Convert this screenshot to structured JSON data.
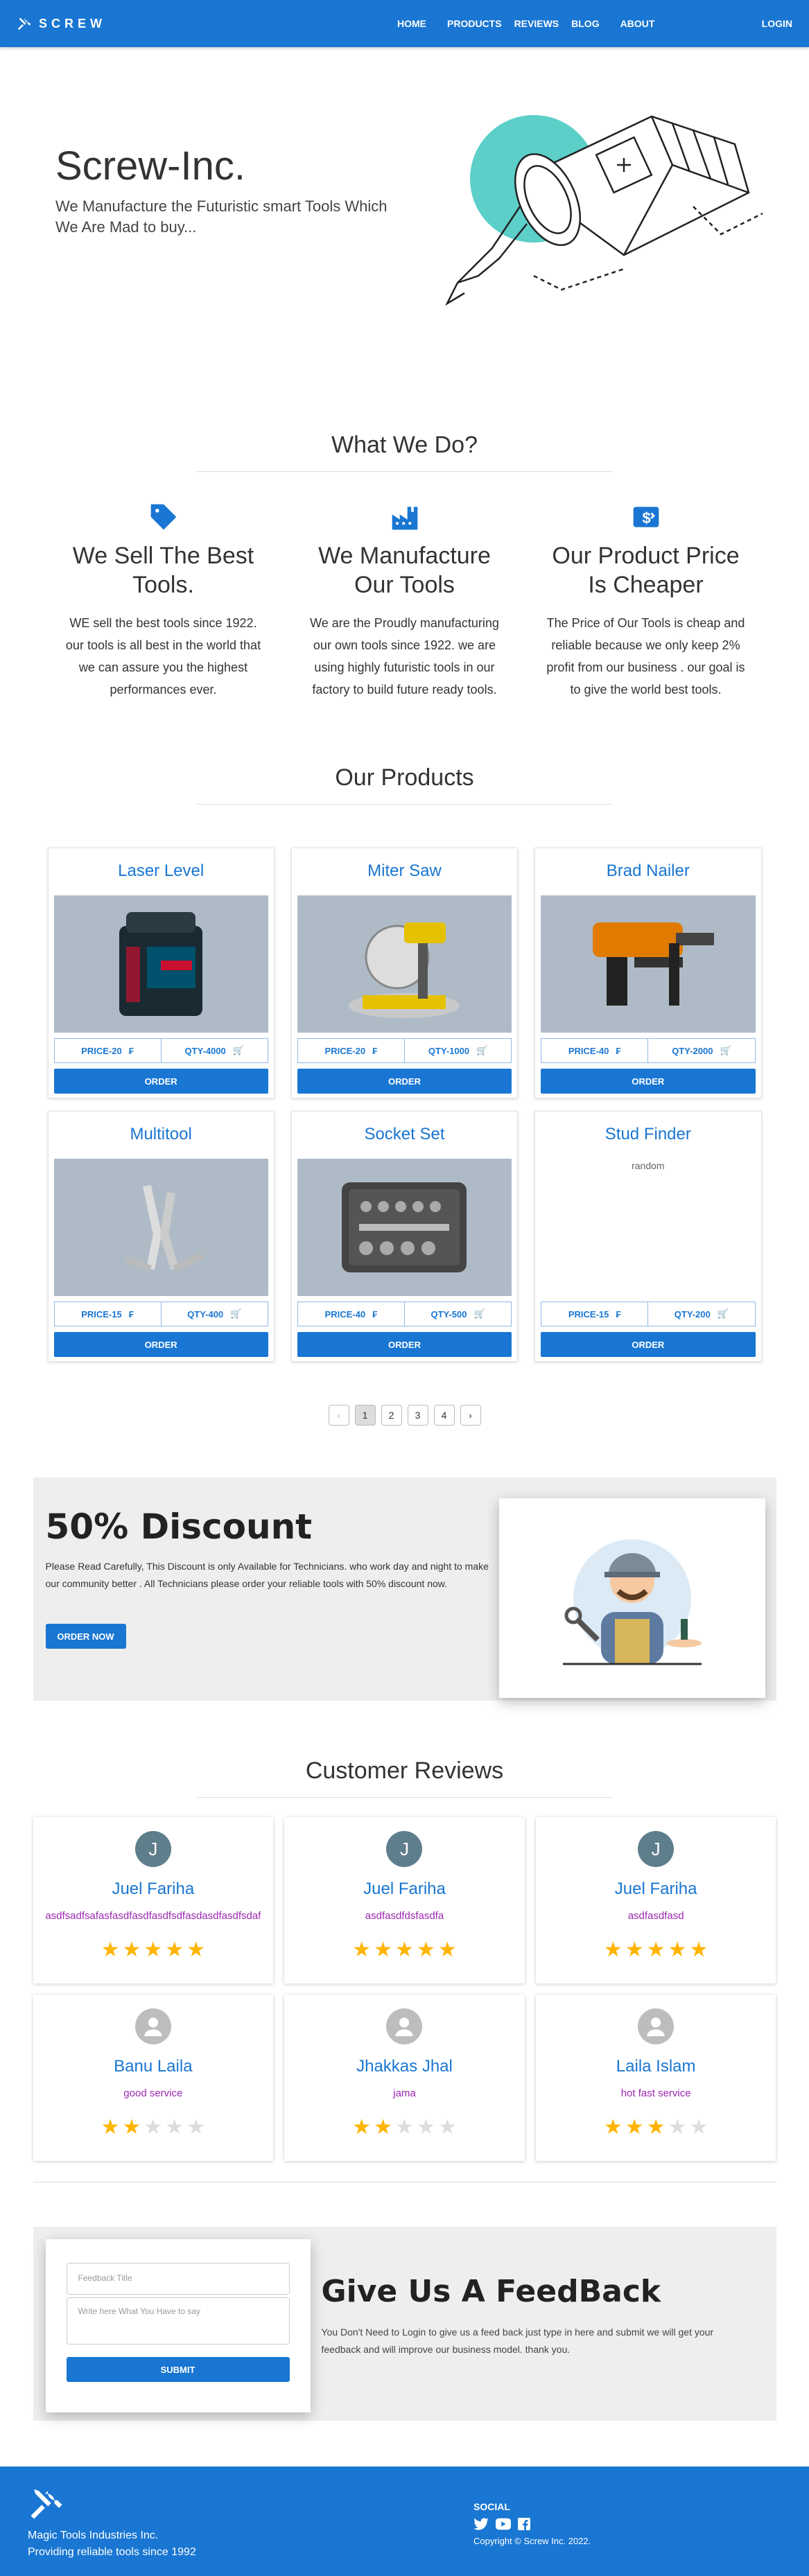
{
  "nav": {
    "brand": "SCREW",
    "items": [
      "HOME",
      "PRODUCTS",
      "REVIEWS",
      "BLOG",
      "ABOUT"
    ],
    "login": "LOGIN"
  },
  "hero": {
    "title": "Screw-Inc.",
    "subtitle": "We Manufacture the Futuristic smart Tools Which We Are Mad to buy..."
  },
  "what": {
    "title": "What We Do?",
    "services": [
      {
        "title": "We Sell The Best Tools.",
        "text": "WE sell the best tools since 1922. our tools is all best in the world that we can assure you the highest performances ever.",
        "icon": "tag-icon"
      },
      {
        "title": "We Manufacture Our Tools",
        "text": "We are the Proudly manufacturing our own tools since 1922. we are using highly futuristic tools in our factory to build future ready tools.",
        "icon": "factory-icon"
      },
      {
        "title": "Our Product Price Is Cheaper",
        "text": "The Price of Our Tools is cheap and reliable because we only keep 2% profit from our business . our goal is to give the world best tools.",
        "icon": "money-icon"
      }
    ]
  },
  "products": {
    "title": "Our Products",
    "order_label": "ORDER",
    "items": [
      {
        "name": "Laser Level",
        "price": "PRICE-20",
        "qty": "QTY-4000"
      },
      {
        "name": "Miter Saw",
        "price": "PRICE-20",
        "qty": "QTY-1000"
      },
      {
        "name": "Brad Nailer",
        "price": "PRICE-40",
        "qty": "QTY-2000"
      },
      {
        "name": "Multitool",
        "price": "PRICE-15",
        "qty": "QTY-400"
      },
      {
        "name": "Socket Set",
        "price": "PRICE-40",
        "qty": "QTY-500"
      },
      {
        "name": "Stud Finder",
        "price": "PRICE-15",
        "qty": "QTY-200",
        "alt": "random"
      }
    ]
  },
  "pagination": {
    "pages": [
      "1",
      "2",
      "3",
      "4"
    ],
    "active": "1"
  },
  "discount": {
    "title": "50% Discount",
    "text": "Please Read Carefully, This Discount is only Available for Technicians. who work day and night to make our community better . All Technicians please order your reliable tools with 50% discount now.",
    "button": "ORDER NOW"
  },
  "reviews": {
    "title": "Customer Reviews",
    "items": [
      {
        "initial": "J",
        "name": "Juel Fariha",
        "text": "asdfsadfsafasfasdfasdfasdfsdfasdasdfasdfsdaf",
        "rating": 5
      },
      {
        "initial": "J",
        "name": "Juel Fariha",
        "text": "asdfasdfdsfasdfa",
        "rating": 5
      },
      {
        "initial": "J",
        "name": "Juel Fariha",
        "text": "asdfasdfasd",
        "rating": 5
      },
      {
        "initial": "",
        "name": "Banu Laila",
        "text": "good service",
        "rating": 2
      },
      {
        "initial": "",
        "name": "Jhakkas Jhal",
        "text": "jama",
        "rating": 2
      },
      {
        "initial": "",
        "name": "Laila Islam",
        "text": "hot fast service",
        "rating": 3
      }
    ]
  },
  "feedback": {
    "title_placeholder": "Feedback Title",
    "text_placeholder": "Write here What You Have to say",
    "submit": "SUBMIT",
    "heading": "Give Us A FeedBack",
    "text": "You Don't Need to Login to give us a feed back just type in here and submit we will get your feedback and will improve our business model. thank you."
  },
  "footer": {
    "company": "Magic Tools Industries Inc.",
    "tagline": "Providing reliable tools since 1992",
    "social_title": "SOCIAL",
    "copyright": "Copyright © Screw Inc. 2022."
  },
  "colors": {
    "primary": "#1976d2",
    "star": "#ffb400",
    "review_text": "#9c27b0"
  }
}
